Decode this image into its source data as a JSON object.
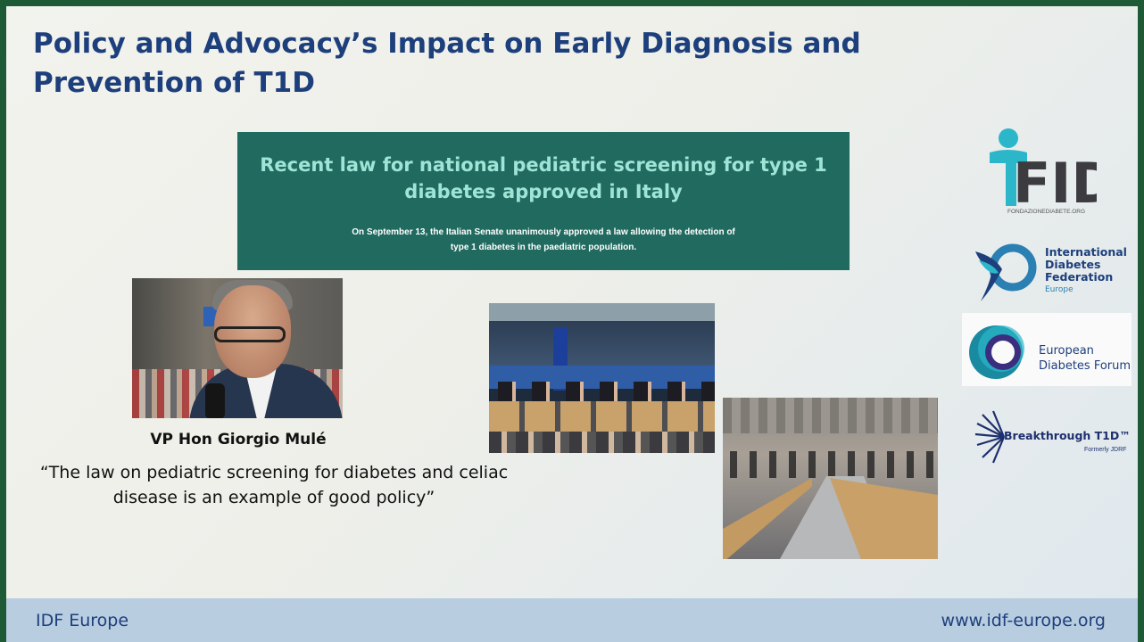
{
  "slide": {
    "title": "Policy and Advocacy’s Impact on Early Diagnosis and Prevention of T1D"
  },
  "banner": {
    "heading": "Recent law for national pediatric screening for type 1 diabetes approved in Italy",
    "body": "On September 13, the Italian Senate unanimously approved a law allowing the detection of type 1 diabetes in the paediatric population."
  },
  "caption": {
    "name": "VP Hon Giorgio Mulé",
    "quote": "“The law on pediatric screening for diabetes and celiac disease is an example of good policy”"
  },
  "logos": {
    "fid": {
      "text": "FID",
      "url": "FONDAZIONEDIABETE.ORG"
    },
    "idf": {
      "line1": "International",
      "line2": "Diabetes",
      "line3": "Federation",
      "sub": "Europe"
    },
    "edf": {
      "line1": "European",
      "line2": "Diabetes Forum"
    },
    "breakthrough": {
      "name": "Breakthrough T1D™",
      "sub": "Formerly JDRF"
    }
  },
  "footer": {
    "left": "IDF Europe",
    "right": "www.idf-europe.org"
  },
  "colors": {
    "title": "#1d3f7c",
    "banner_bg": "#216a5f",
    "banner_heading": "#9fe4d6",
    "footer_bg": "#b8cde0",
    "frame": "#1f5a36"
  }
}
